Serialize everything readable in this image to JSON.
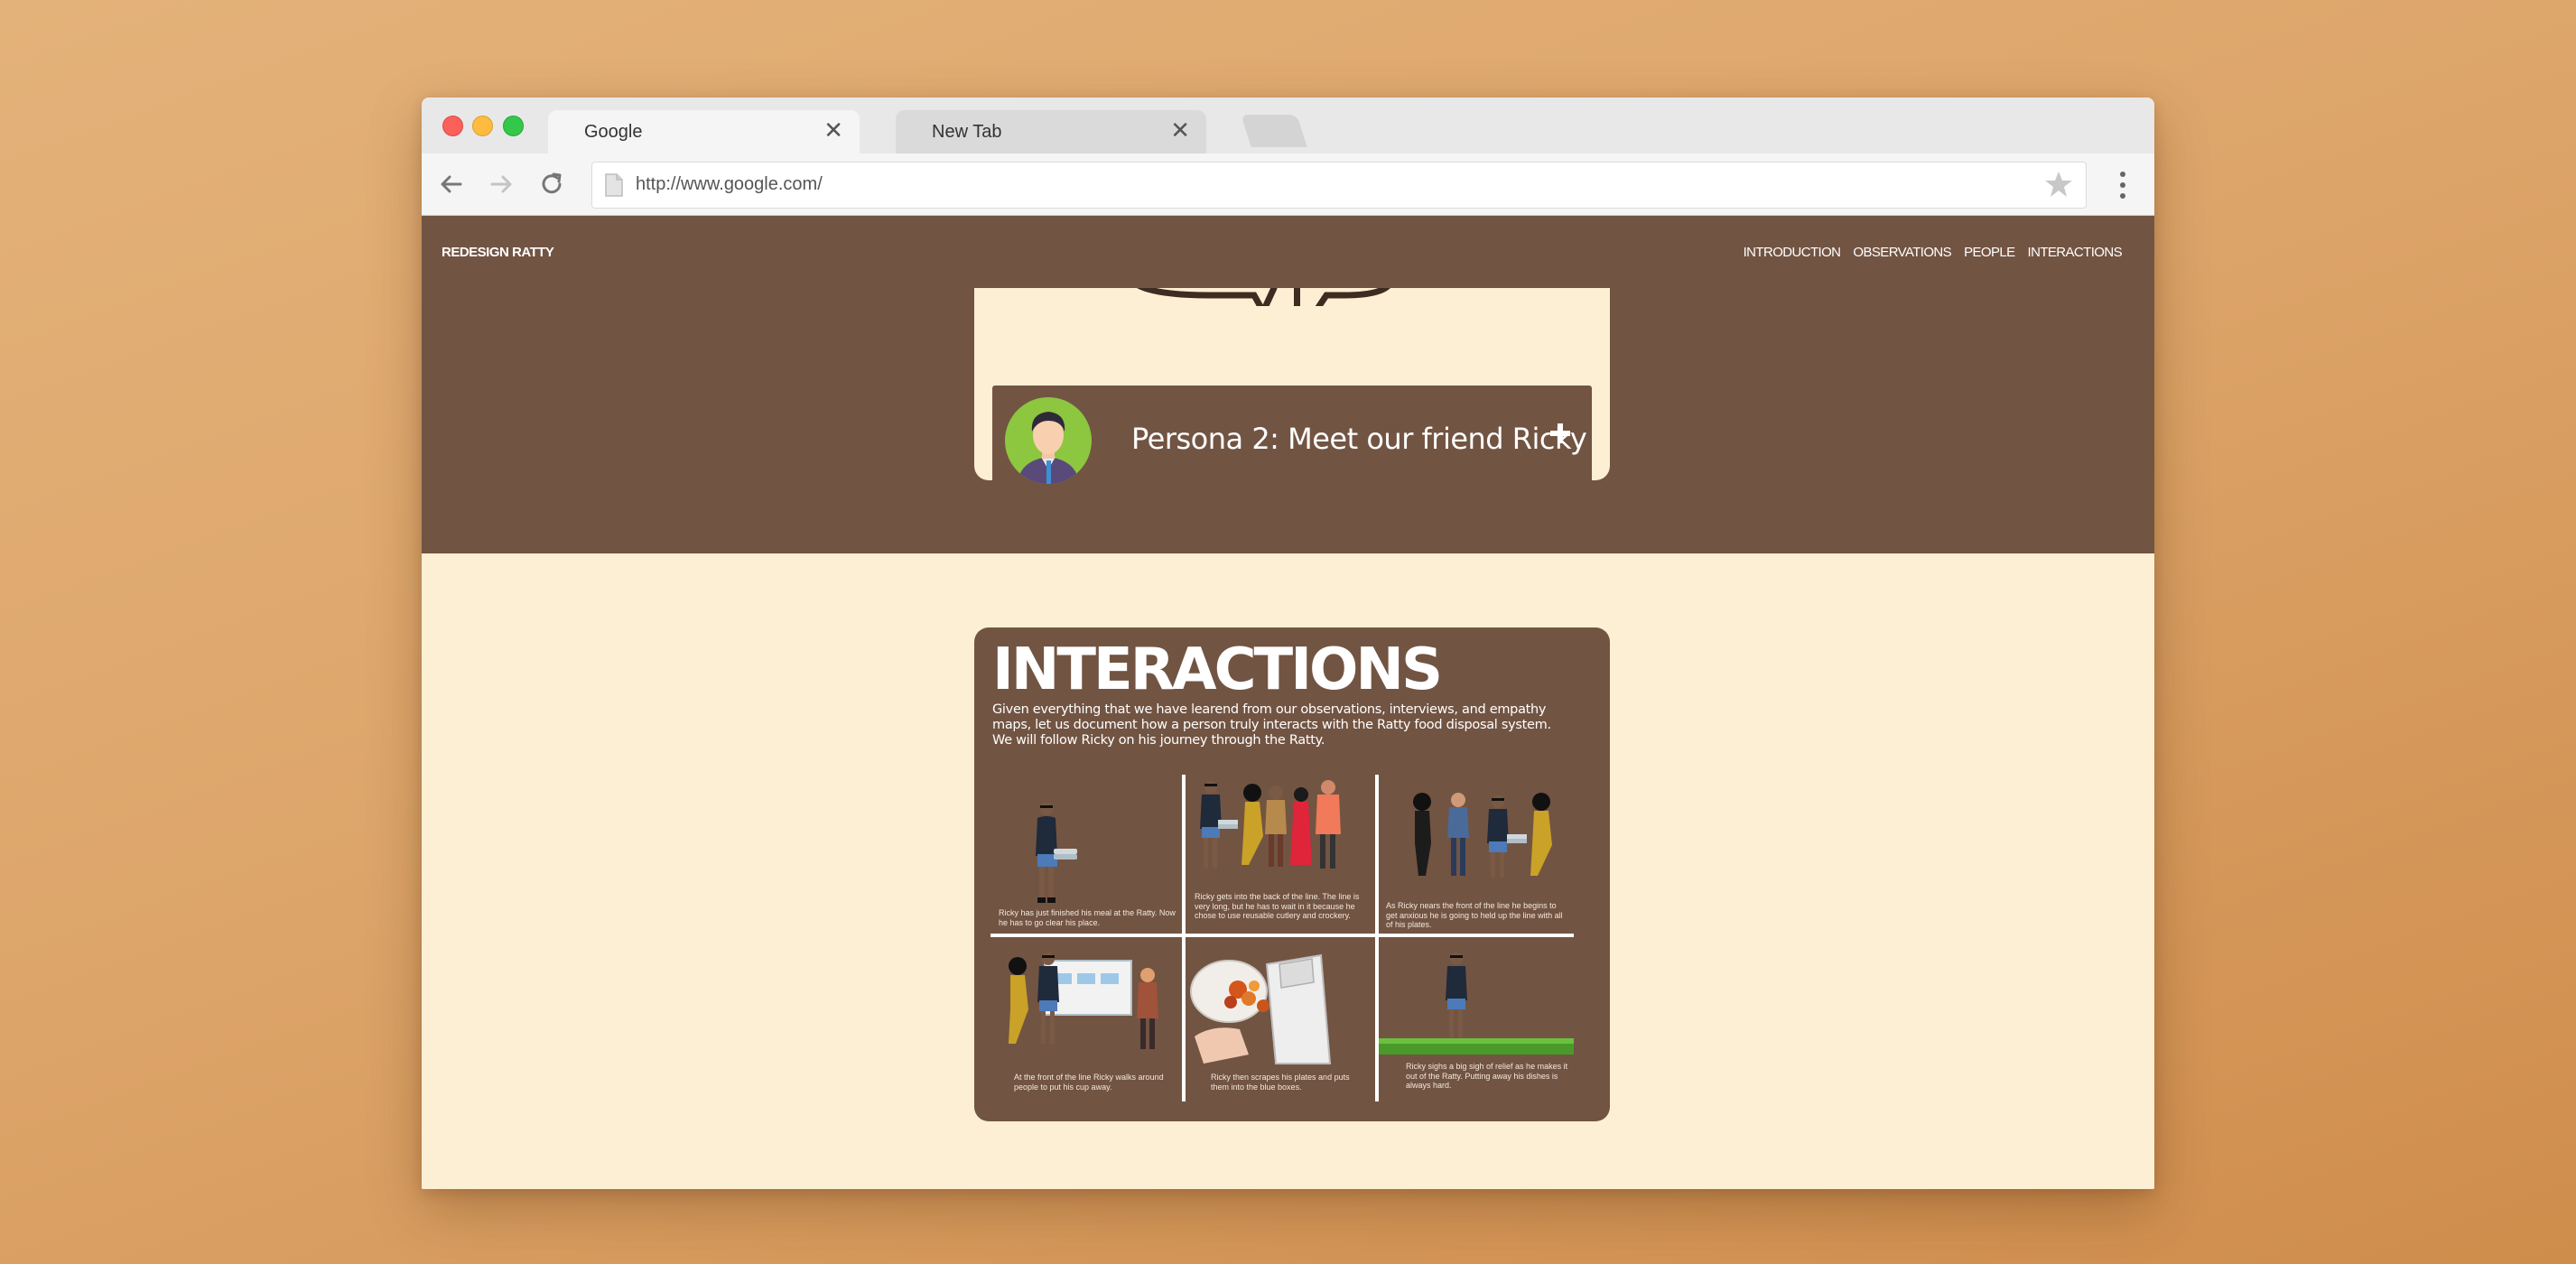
{
  "browser": {
    "tabs": [
      {
        "label": "Google",
        "close": "✕"
      },
      {
        "label": "New Tab",
        "close": "✕"
      }
    ],
    "address_url": "http://www.google.com/"
  },
  "site": {
    "brand": "REDESIGN RATTY",
    "nav": [
      "INTRODUCTION",
      "OBSERVATIONS",
      "PEOPLE",
      "INTERACTIONS"
    ]
  },
  "persona": {
    "title": "Persona 2: Meet our friend Ricky",
    "expand_icon": "plus-icon"
  },
  "interactions": {
    "heading": "INTERACTIONS",
    "description": "Given everything that we have learend from our observations, interviews, and empathy maps, let us document how a person truly interacts with the Ratty food disposal system. We will follow Ricky on his journey through the Ratty.",
    "panels": [
      {
        "caption": "Ricky has just finished his meal at the Ratty. Now he has to go clear his place."
      },
      {
        "caption": "Ricky gets into the back of the line. The line is very long, but he has to wait in it because he chose to use reusable cutlery and crockery."
      },
      {
        "caption": "As Ricky nears the front of the line he begins to get anxious he is going to held up the line with all of his plates."
      },
      {
        "caption": "At the front of the line Ricky walks around people to put his cup away."
      },
      {
        "caption": "Ricky then scrapes his plates and puts them into the blue boxes."
      },
      {
        "caption": "Ricky sighs a big sigh of relief as he makes it out of the Ratty. Putting away his dishes is always hard."
      }
    ]
  },
  "colors": {
    "brown": "#725443",
    "cream": "#fdefd3",
    "accent_green": "#8dc63f"
  }
}
